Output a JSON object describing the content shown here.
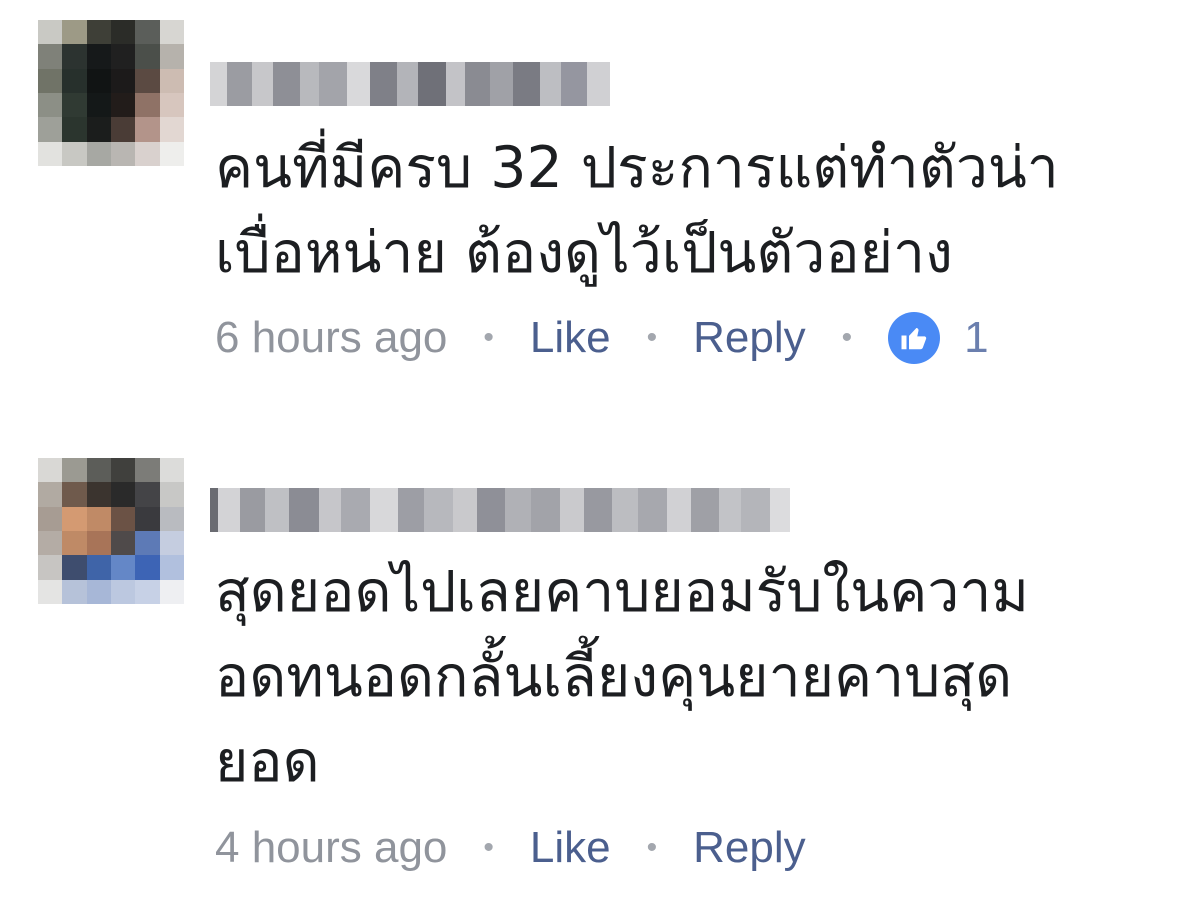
{
  "comments": [
    {
      "author": "",
      "text": "คนที่มีครบ 32 ประการแต่ทำตัวน่า\nเบื่อหน่าย ต้องดูไว้เป็นตัวอย่าง",
      "timestamp": "6 hours ago",
      "like_label": "Like",
      "reply_label": "Reply",
      "reaction_icon": "thumbs-up-icon",
      "reaction_count": "1"
    },
    {
      "author": "",
      "text": "สุดยอดไปเลยคาบยอมรับในความ\nอดทนอดกลั้นเลี้ยงคุนยายคาบสุด\nยอด",
      "timestamp": "4 hours ago",
      "like_label": "Like",
      "reply_label": "Reply"
    }
  ],
  "colors": {
    "text": "#1c1e21",
    "timestamp": "#90949c",
    "link": "#4b5f8e",
    "reaction_badge": "#4a8af5"
  }
}
